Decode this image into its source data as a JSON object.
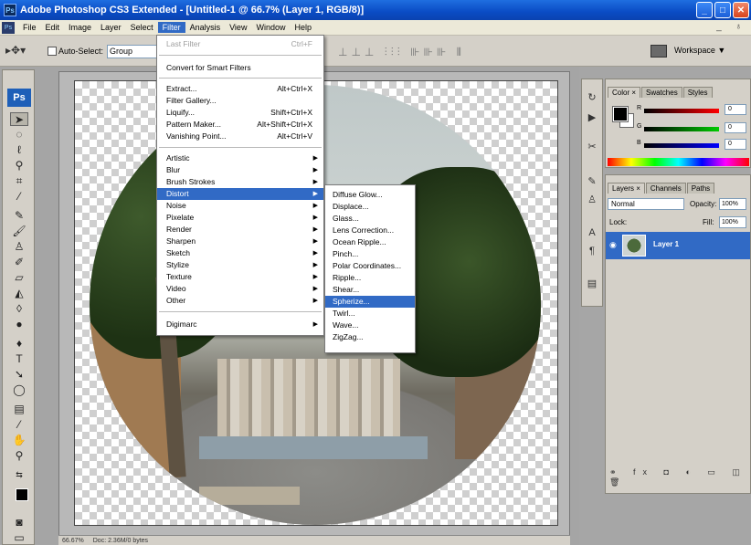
{
  "window": {
    "title": "Adobe Photoshop CS3 Extended - [Untitled-1 @ 66.7% (Layer 1, RGB/8)]"
  },
  "menubar": {
    "items": [
      "File",
      "Edit",
      "Image",
      "Layer",
      "Select",
      "Filter",
      "Analysis",
      "View",
      "Window",
      "Help"
    ],
    "active": "Filter"
  },
  "options": {
    "auto_select_label": "Auto-Select:",
    "auto_select_value": "Group",
    "workspace_label": "Workspace ▼"
  },
  "filter_menu": {
    "last_filter": {
      "label": "Last Filter",
      "shortcut": "Ctrl+F"
    },
    "convert": "Convert for Smart Filters",
    "group2": [
      {
        "label": "Extract...",
        "shortcut": "Alt+Ctrl+X"
      },
      {
        "label": "Filter Gallery...",
        "shortcut": ""
      },
      {
        "label": "Liquify...",
        "shortcut": "Shift+Ctrl+X"
      },
      {
        "label": "Pattern Maker...",
        "shortcut": "Alt+Shift+Ctrl+X"
      },
      {
        "label": "Vanishing Point...",
        "shortcut": "Alt+Ctrl+V"
      }
    ],
    "group3": [
      "Artistic",
      "Blur",
      "Brush Strokes",
      "Distort",
      "Noise",
      "Pixelate",
      "Render",
      "Sharpen",
      "Sketch",
      "Stylize",
      "Texture",
      "Video",
      "Other"
    ],
    "highlighted": "Distort",
    "digimarc": "Digimarc"
  },
  "distort_submenu": {
    "items": [
      "Diffuse Glow...",
      "Displace...",
      "Glass...",
      "Lens Correction...",
      "Ocean Ripple...",
      "Pinch...",
      "Polar Coordinates...",
      "Ripple...",
      "Shear...",
      "Spherize...",
      "Twirl...",
      "Wave...",
      "ZigZag..."
    ],
    "highlighted": "Spherize..."
  },
  "color_panel": {
    "tabs": [
      "Color ×",
      "Swatches",
      "Styles"
    ],
    "rows": [
      {
        "label": "R",
        "value": "0"
      },
      {
        "label": "G",
        "value": "0"
      },
      {
        "label": "B",
        "value": "0"
      }
    ]
  },
  "layers_panel": {
    "tabs": [
      "Layers ×",
      "Channels",
      "Paths"
    ],
    "blend_mode": "Normal",
    "opacity_label": "Opacity:",
    "opacity_value": "100%",
    "lock_label": "Lock:",
    "fill_label": "Fill:",
    "fill_value": "100%",
    "layer_name": "Layer 1",
    "footer": "⚭ fx ◘ ◐ ▭ ◫ 🗑"
  },
  "status": {
    "zoom": "66.67%",
    "doc": "Doc: 2.36M/0 bytes"
  },
  "toolbox": {
    "logo": "Ps"
  }
}
